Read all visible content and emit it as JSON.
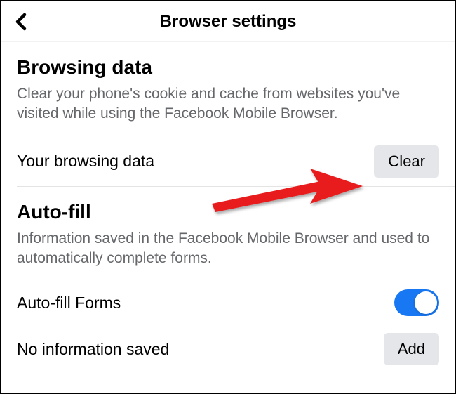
{
  "header": {
    "title": "Browser settings"
  },
  "browsing_data": {
    "title": "Browsing data",
    "description": "Clear your phone's cookie and cache from websites you've visited while using the Facebook Mobile Browser.",
    "row_label": "Your browsing data",
    "clear_button": "Clear"
  },
  "autofill": {
    "title": "Auto-fill",
    "description": "Information saved in the Facebook Mobile Browser and used to automatically complete forms.",
    "forms_label": "Auto-fill Forms",
    "forms_toggle_on": true,
    "no_info_label": "No information saved",
    "add_button": "Add"
  }
}
